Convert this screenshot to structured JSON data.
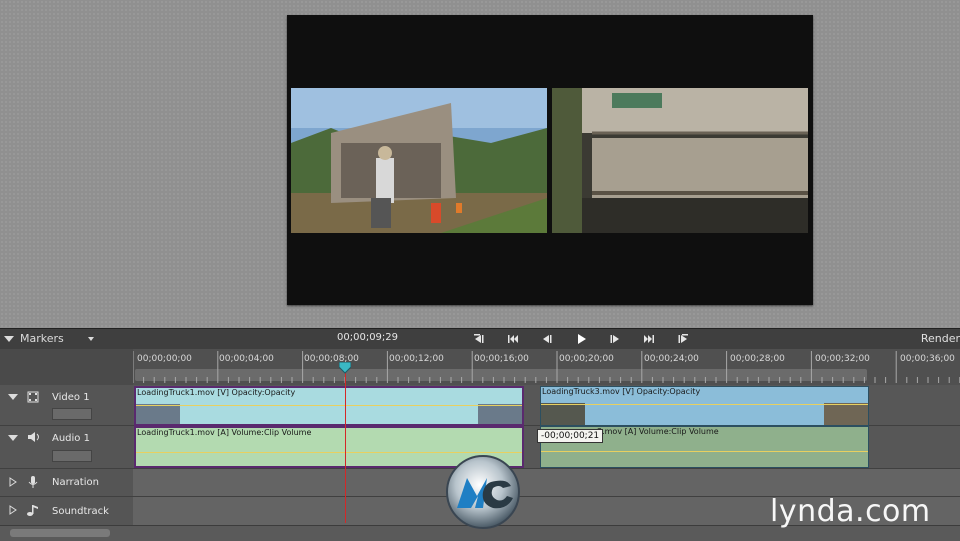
{
  "controls": {
    "markers_label": "Markers",
    "timecode": "00;00;09;29",
    "render_label": "Render",
    "transport_buttons": [
      "go-to-in-point",
      "go-to-start",
      "step-back",
      "play",
      "step-forward",
      "go-to-end",
      "go-to-out-point"
    ]
  },
  "ruler": {
    "ticks": [
      "00;00;00;00",
      "00;00;04;00",
      "00;00;08;00",
      "00;00;12;00",
      "00;00;16;00",
      "00;00;20;00",
      "00;00;24;00",
      "00;00;28;00",
      "00;00;32;00",
      "00;00;36;00"
    ]
  },
  "tracks": {
    "video1": {
      "name": "Video 1",
      "clip1_label": "LoadingTruck1.mov [V] Opacity:Opacity",
      "clip2_label": "LoadingTruck3.mov [V] Opacity:Opacity"
    },
    "audio1": {
      "name": "Audio 1",
      "clip1_label": "LoadingTruck1.mov [A] Volume:Clip Volume",
      "clip2_label": "3.mov [A] Volume:Clip Volume"
    },
    "narration": {
      "name": "Narration"
    },
    "soundtrack": {
      "name": "Soundtrack"
    }
  },
  "tooltip": {
    "text": "-00;00;00;21"
  },
  "watermark": {
    "text": "lynda.com"
  },
  "colors": {
    "playhead": "#d32828",
    "video_clip": "#a9dbe0",
    "audio_clip": "#b3dab0",
    "selection_border": "#5a2a6e"
  }
}
